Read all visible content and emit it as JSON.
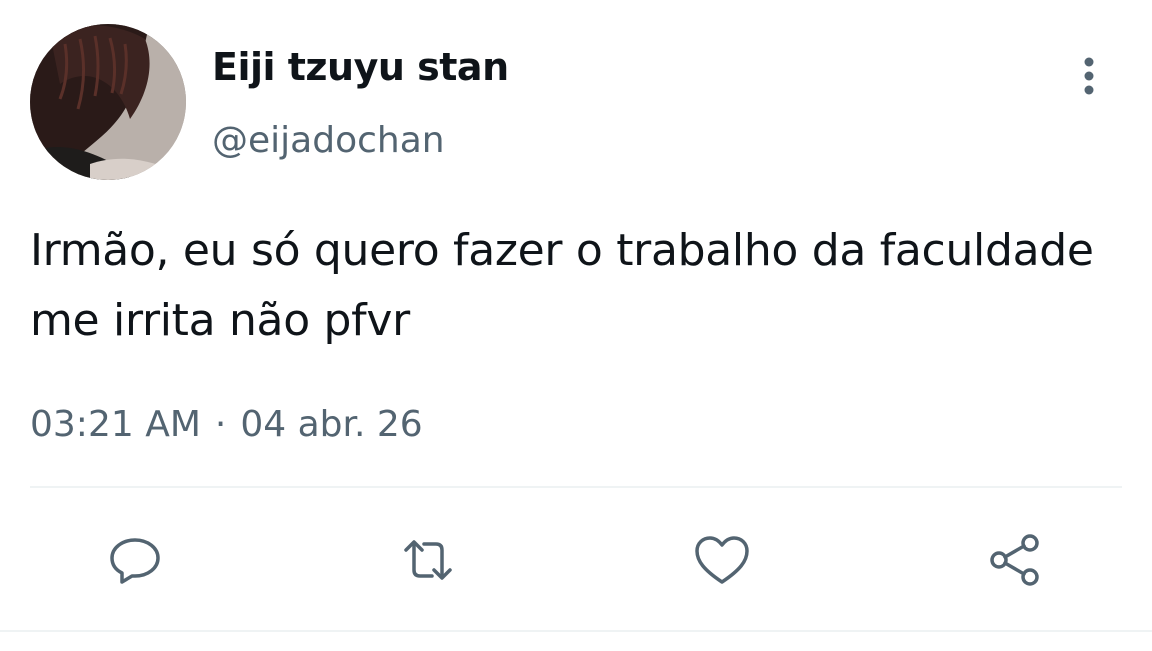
{
  "user": {
    "display_name": "Eiji tzuyu stan",
    "handle": "@eijadochan",
    "avatar_icon": "avatar"
  },
  "tweet": {
    "text": "Irmão, eu só quero fazer o trabalho da faculdade me irrita não pfvr",
    "time": "03:21 AM",
    "separator": "·",
    "date": "04 abr. 26"
  },
  "actions": {
    "icons": [
      "reply-icon",
      "retweet-icon",
      "like-icon",
      "share-icon"
    ]
  },
  "colors": {
    "text": "#0f1419",
    "secondary": "#536471",
    "divider": "#eff3f4"
  }
}
